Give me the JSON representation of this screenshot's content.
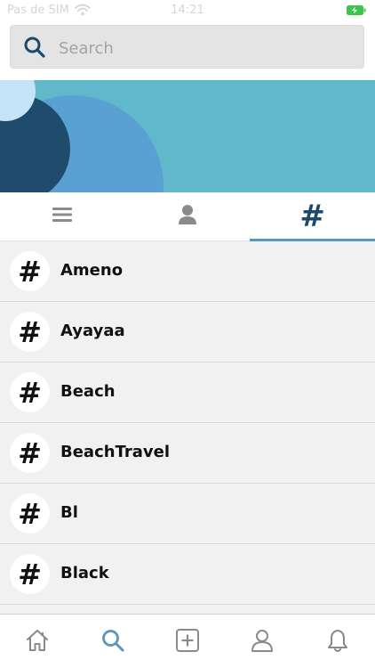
{
  "status_bar": {
    "carrier": "Pas de SIM",
    "time": "14:21",
    "wifi_icon": "wifi-icon",
    "battery_icon": "battery-charging-icon"
  },
  "search": {
    "placeholder": "Search",
    "value": "",
    "icon": "search-icon"
  },
  "tabs": [
    {
      "name": "list",
      "icon": "menu-icon",
      "active": false
    },
    {
      "name": "people",
      "icon": "person-icon",
      "active": false
    },
    {
      "name": "tags",
      "icon": "hashtag-icon",
      "label": "#",
      "active": true
    }
  ],
  "tags": [
    {
      "symbol": "#",
      "name": "Ameno"
    },
    {
      "symbol": "#",
      "name": "Ayayaa"
    },
    {
      "symbol": "#",
      "name": "Beach"
    },
    {
      "symbol": "#",
      "name": "BeachTravel"
    },
    {
      "symbol": "#",
      "name": "Bl"
    },
    {
      "symbol": "#",
      "name": "Black"
    }
  ],
  "bottom_nav": [
    {
      "name": "home",
      "icon": "home-icon",
      "active": false
    },
    {
      "name": "search",
      "icon": "search-icon",
      "active": true
    },
    {
      "name": "add",
      "icon": "add-post-icon",
      "active": false
    },
    {
      "name": "profile",
      "icon": "profile-icon",
      "active": false
    },
    {
      "name": "notifications",
      "icon": "bell-icon",
      "active": false
    }
  ],
  "colors": {
    "accent": "#5b96bb",
    "dark_accent": "#1d4a6c",
    "banner": "#62b8cb",
    "icon_gray": "#8a8a8a"
  }
}
